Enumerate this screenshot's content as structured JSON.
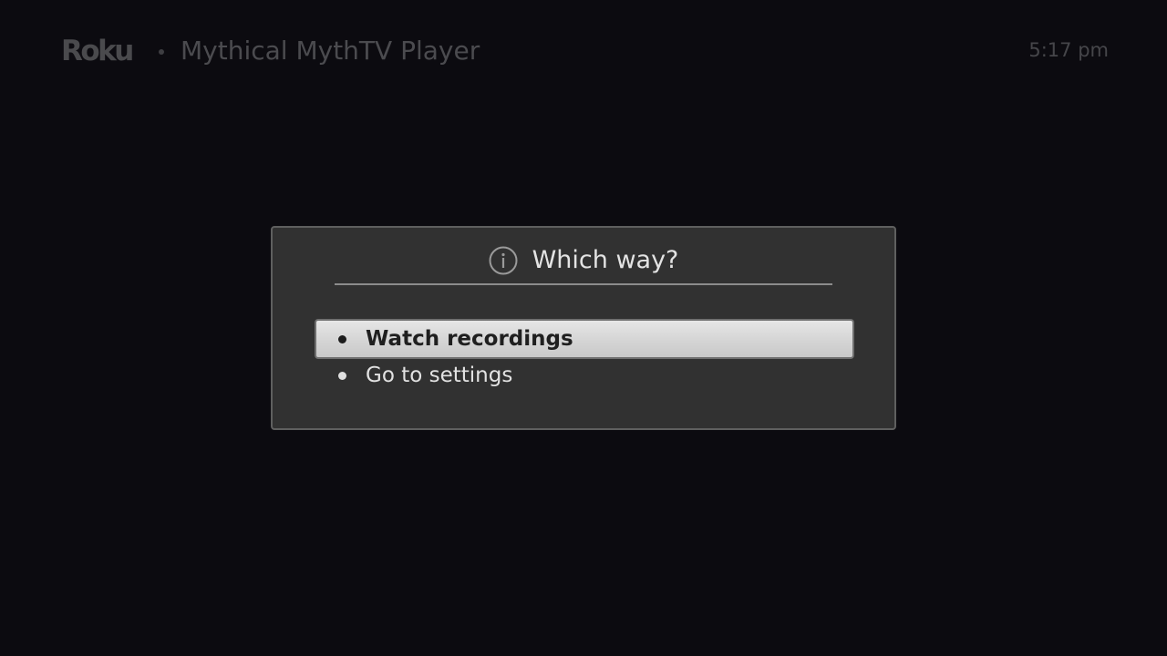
{
  "header": {
    "brand": "Roku",
    "app_title": "Mythical MythTV Player",
    "clock": "5:17 pm"
  },
  "dialog": {
    "icon": "info-icon",
    "title": "Which way?",
    "options": [
      {
        "label": "Watch recordings",
        "selected": true
      },
      {
        "label": "Go to settings",
        "selected": false
      }
    ]
  },
  "colors": {
    "background": "#0c0b10",
    "dialog_background": "#313131",
    "dialog_border": "#5f5f5f",
    "selection_highlight": "#d6d6d6",
    "header_text": "#4b4b4f"
  }
}
